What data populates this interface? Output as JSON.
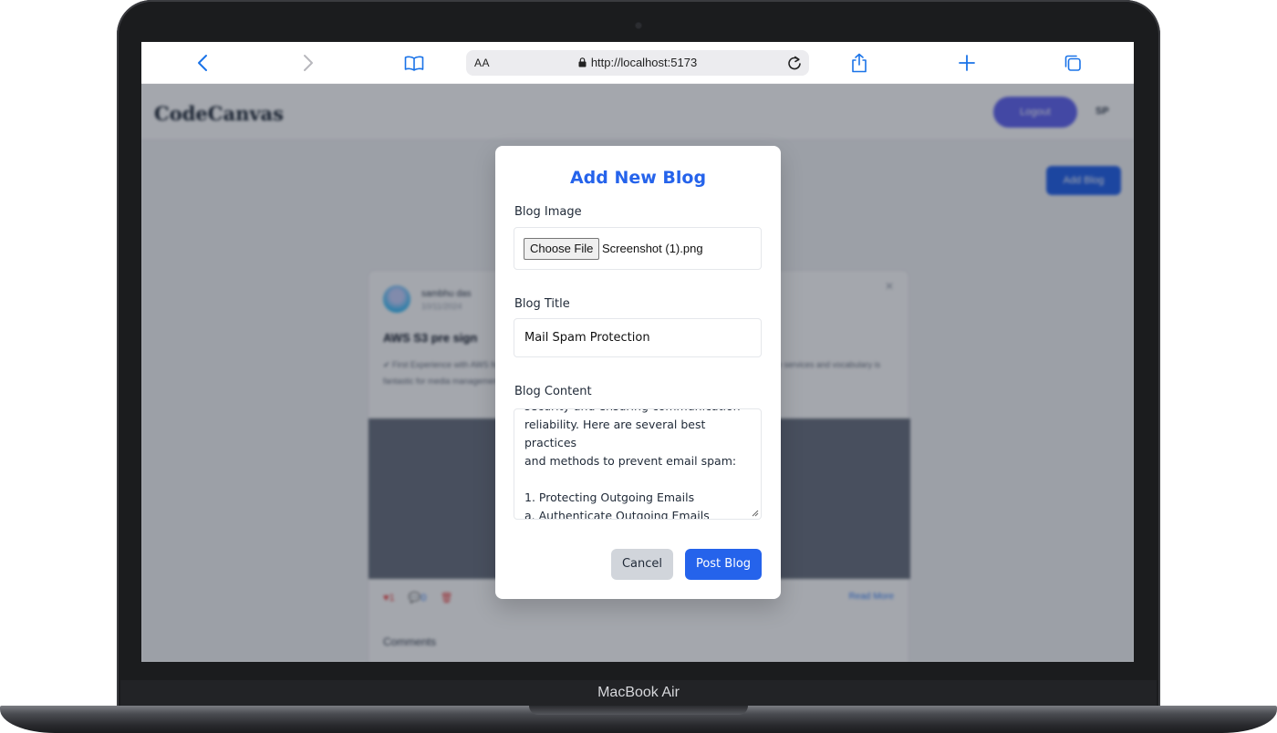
{
  "device": {
    "label": "MacBook Air"
  },
  "browser": {
    "url": "http://localhost:5173",
    "text_size_label": "AA"
  },
  "site": {
    "brand": "CodeCanvas",
    "logout_label": "Logout",
    "user_initials": "SP",
    "add_blog_label": "Add Blog",
    "card": {
      "author": "sambhu das",
      "date": "10/11/2024",
      "title": "AWS S3 pre sign",
      "excerpt": "✔ First Experience with AWS for the first time. I recently worked with AWS for the first time, and I must say the services and vocabulary is fantastic for media management and the infrastructure and archives...",
      "read_more": "Read More",
      "comments_label": "Comments",
      "likes": "1",
      "comment_count": "0"
    }
  },
  "modal": {
    "title": "Add New Blog",
    "image_label": "Blog Image",
    "choose_file_label": "Choose File",
    "file_name": "Screenshot (1).png",
    "title_label": "Blog Title",
    "title_value": "Mail Spam Protection",
    "content_label": "Blog Content",
    "content_value": "security and ensuring communication\nreliability. Here are several best practices\nand methods to prevent email spam:\n\n1. Protecting Outgoing Emails\na. Authenticate Outgoing Emails\nUse SPF (Sender Policy Framework):",
    "cancel_label": "Cancel",
    "post_label": "Post Blog",
    "accent_color": "#2563eb"
  }
}
